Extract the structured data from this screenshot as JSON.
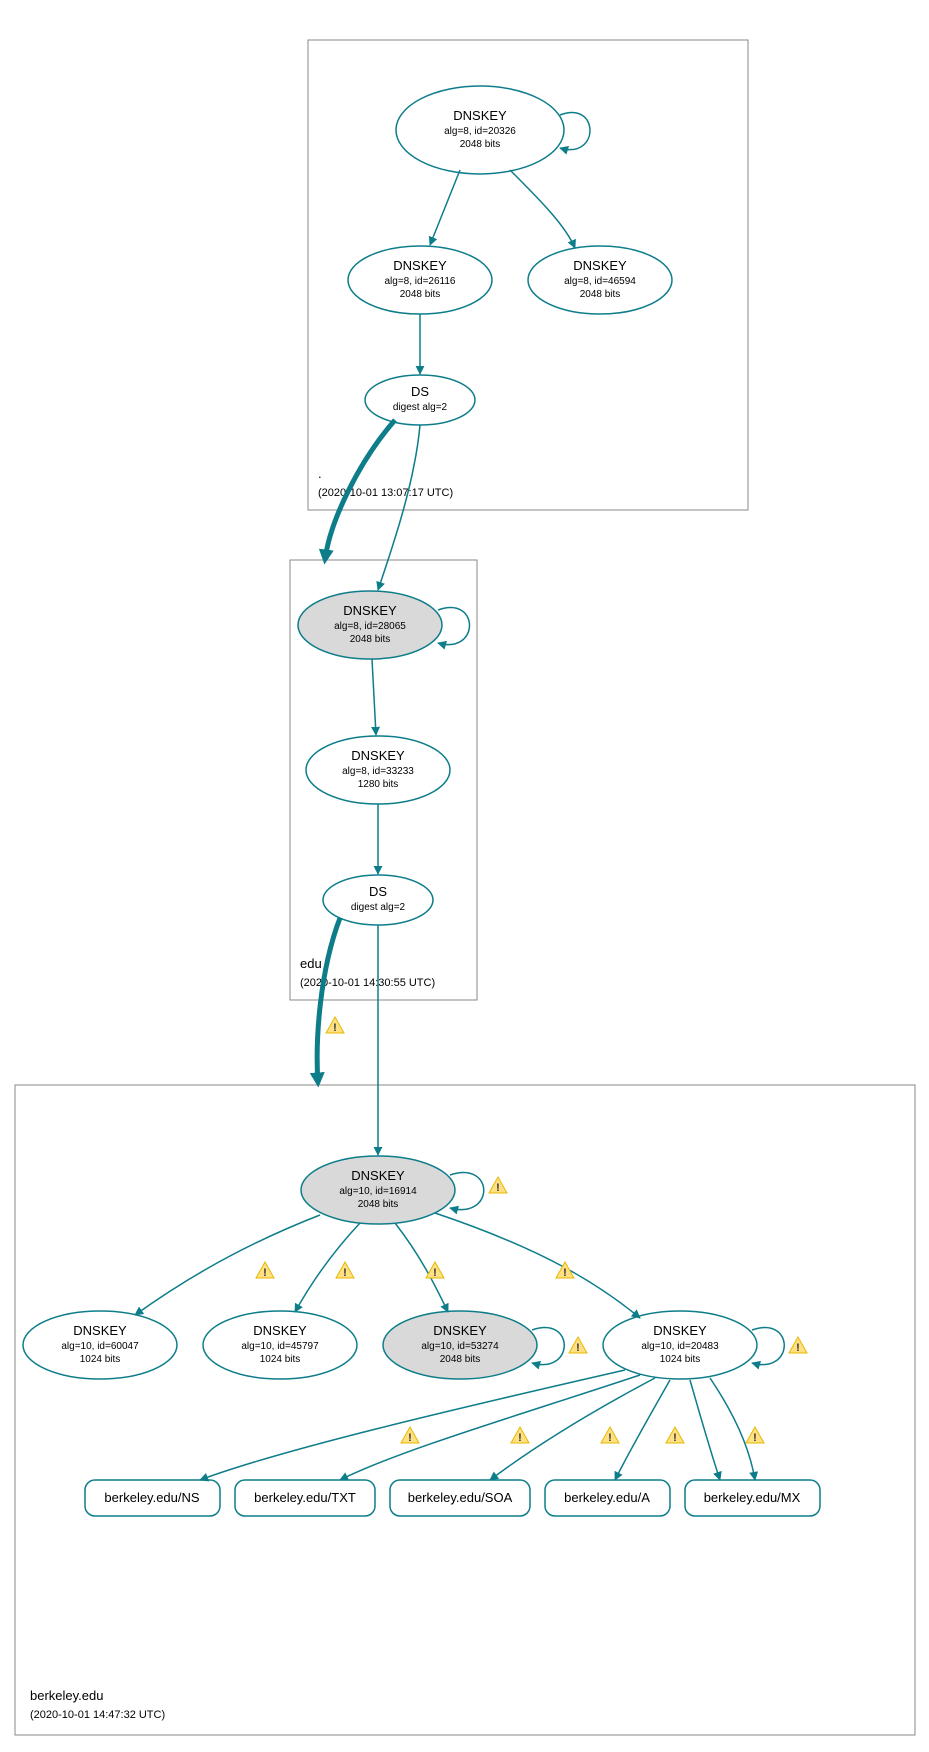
{
  "colors": {
    "stroke": "#0d7d8a",
    "shaded": "#d9d9d9",
    "warn_fill": "#ffe082",
    "warn_stroke": "#e6b800"
  },
  "zones": {
    "root": {
      "label": ".",
      "timestamp": "(2020-10-01 13:07:17 UTC)"
    },
    "edu": {
      "label": "edu",
      "timestamp": "(2020-10-01 14:30:55 UTC)"
    },
    "berkeley": {
      "label": "berkeley.edu",
      "timestamp": "(2020-10-01 14:47:32 UTC)"
    }
  },
  "nodes": {
    "root_ksk": {
      "title": "DNSKEY",
      "line2": "alg=8, id=20326",
      "line3": "2048 bits"
    },
    "root_zsk1": {
      "title": "DNSKEY",
      "line2": "alg=8, id=26116",
      "line3": "2048 bits"
    },
    "root_zsk2": {
      "title": "DNSKEY",
      "line2": "alg=8, id=46594",
      "line3": "2048 bits"
    },
    "root_ds": {
      "title": "DS",
      "line2": "digest alg=2"
    },
    "edu_ksk": {
      "title": "DNSKEY",
      "line2": "alg=8, id=28065",
      "line3": "2048 bits"
    },
    "edu_zsk": {
      "title": "DNSKEY",
      "line2": "alg=8, id=33233",
      "line3": "1280 bits"
    },
    "edu_ds": {
      "title": "DS",
      "line2": "digest alg=2"
    },
    "b_ksk": {
      "title": "DNSKEY",
      "line2": "alg=10, id=16914",
      "line3": "2048 bits"
    },
    "b_zsk1": {
      "title": "DNSKEY",
      "line2": "alg=10, id=60047",
      "line3": "1024 bits"
    },
    "b_zsk2": {
      "title": "DNSKEY",
      "line2": "alg=10, id=45797",
      "line3": "1024 bits"
    },
    "b_zsk3": {
      "title": "DNSKEY",
      "line2": "alg=10, id=53274",
      "line3": "2048 bits"
    },
    "b_zsk4": {
      "title": "DNSKEY",
      "line2": "alg=10, id=20483",
      "line3": "1024 bits"
    },
    "rr_ns": {
      "title": "berkeley.edu/NS"
    },
    "rr_txt": {
      "title": "berkeley.edu/TXT"
    },
    "rr_soa": {
      "title": "berkeley.edu/SOA"
    },
    "rr_a": {
      "title": "berkeley.edu/A"
    },
    "rr_mx": {
      "title": "berkeley.edu/MX"
    }
  }
}
